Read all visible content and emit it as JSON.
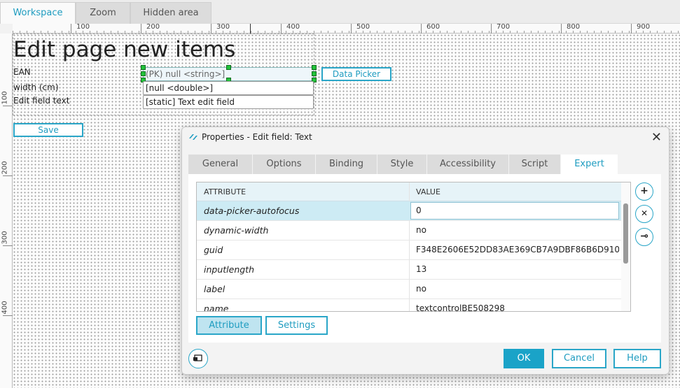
{
  "top_tabs": [
    {
      "label": "Workspace"
    },
    {
      "label": "Zoom"
    },
    {
      "label": "Hidden area"
    }
  ],
  "ruler": {
    "horizontal": [
      "100",
      "200",
      "300",
      "400",
      "500",
      "600",
      "700",
      "800",
      "900"
    ],
    "vertical": [
      "100",
      "200",
      "300",
      "400"
    ]
  },
  "canvas": {
    "page_title": "Edit page new items",
    "fields": [
      {
        "label": "EAN",
        "value": "(PK) null <string>]"
      },
      {
        "label": "width (cm)",
        "value": "[null <double>]"
      },
      {
        "label": "Edit field text",
        "value": "[static] Text edit field"
      }
    ],
    "data_picker_label": "Data Picker",
    "save_label": "Save"
  },
  "dialog": {
    "title": "Properties - Edit field: Text",
    "close_glyph": "✕",
    "tabs": [
      {
        "label": "General"
      },
      {
        "label": "Options"
      },
      {
        "label": "Binding"
      },
      {
        "label": "Style"
      },
      {
        "label": "Accessibility"
      },
      {
        "label": "Script"
      },
      {
        "label": "Expert"
      }
    ],
    "active_tab": "Expert",
    "table": {
      "headers": {
        "attribute": "ATTRIBUTE",
        "value": "VALUE"
      },
      "rows": [
        {
          "attribute": "data-picker-autofocus",
          "value": "0"
        },
        {
          "attribute": "dynamic-width",
          "value": "no"
        },
        {
          "attribute": "guid",
          "value": "F348E2606E52DD83AE369CB7A9DBF86B6D910..."
        },
        {
          "attribute": "inputlength",
          "value": "13"
        },
        {
          "attribute": "label",
          "value": "no"
        },
        {
          "attribute": "name",
          "value": "textcontrolBE508298"
        }
      ]
    },
    "side_buttons": {
      "add_glyph": "+",
      "remove_glyph": "✕",
      "key_glyph": "⊸"
    },
    "body_buttons": {
      "attribute": "Attribute",
      "settings": "Settings"
    },
    "footer": {
      "ok": "OK",
      "cancel": "Cancel",
      "help": "Help"
    }
  },
  "colors": {
    "accent": "#1e9cc0",
    "selected_row": "#cdebf4",
    "handle": "#22c33a"
  }
}
